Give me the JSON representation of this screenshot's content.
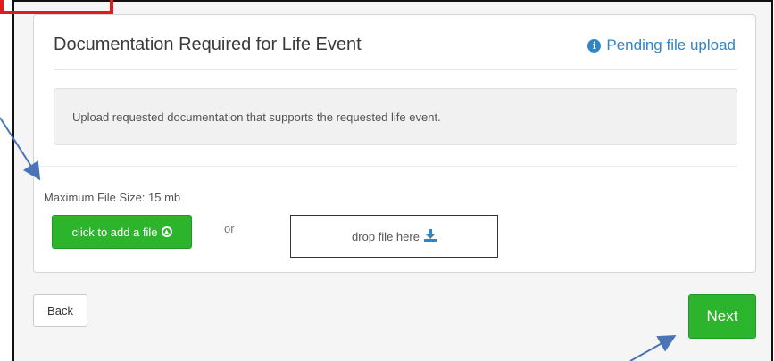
{
  "card": {
    "title": "Documentation Required for Life Event",
    "status": "Pending file upload",
    "status_icon": "info-circle-icon",
    "notice": "Upload requested documentation that supports the requested life event.",
    "max_file_size": "Maximum File Size: 15 mb",
    "add_file_label": "click to add a file",
    "or_text": "or",
    "drop_label": "drop file here"
  },
  "footer": {
    "back_label": "Back",
    "next_label": "Next"
  },
  "colors": {
    "accent_blue": "#2f86c6",
    "button_green": "#2cb52c",
    "annotation_red": "#e01b1b",
    "annotation_arrow": "#4a74b8"
  }
}
